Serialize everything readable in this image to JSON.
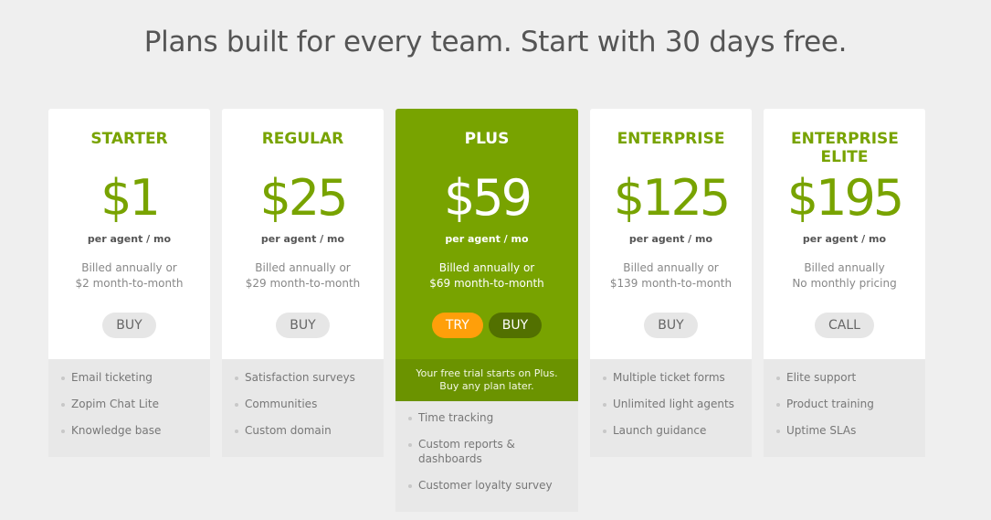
{
  "headline": "Plans built for every team. Start with 30 days free.",
  "plans": [
    {
      "name": "STARTER",
      "price": "$1",
      "per": "per agent / mo",
      "billed_line1": "Billed annually or",
      "billed_line2": "$2 month-to-month",
      "button": "BUY",
      "features": [
        "Email ticketing",
        "Zopim Chat Lite",
        "Knowledge base"
      ]
    },
    {
      "name": "REGULAR",
      "price": "$25",
      "per": "per agent / mo",
      "billed_line1": "Billed annually or",
      "billed_line2": "$29 month-to-month",
      "button": "BUY",
      "features": [
        "Satisfaction surveys",
        "Communities",
        "Custom domain"
      ]
    },
    {
      "name": "PLUS",
      "price": "$59",
      "per": "per agent / mo",
      "billed_line1": "Billed annually or",
      "billed_line2": "$69 month-to-month",
      "try_button": "TRY",
      "button": "BUY",
      "trial_line1": "Your free trial starts on Plus.",
      "trial_line2": "Buy any plan later.",
      "features": [
        "Time tracking",
        "Custom reports & dashboards",
        "Customer loyalty survey"
      ]
    },
    {
      "name": "ENTERPRISE",
      "price": "$125",
      "per": "per agent / mo",
      "billed_line1": "Billed annually or",
      "billed_line2": "$139 month-to-month",
      "button": "BUY",
      "features": [
        "Multiple ticket forms",
        "Unlimited light agents",
        "Launch guidance"
      ]
    },
    {
      "name": "ENTERPRISE ELITE",
      "price": "$195",
      "per": "per agent / mo",
      "billed_line1": "Billed annually",
      "billed_line2": "No monthly pricing",
      "button": "CALL",
      "features": [
        "Elite support",
        "Product training",
        "Uptime SLAs"
      ]
    }
  ],
  "colors": {
    "brand_green": "#78a300",
    "dark_green": "#527000",
    "try_orange": "#ff9f0a",
    "background": "#efefef"
  }
}
